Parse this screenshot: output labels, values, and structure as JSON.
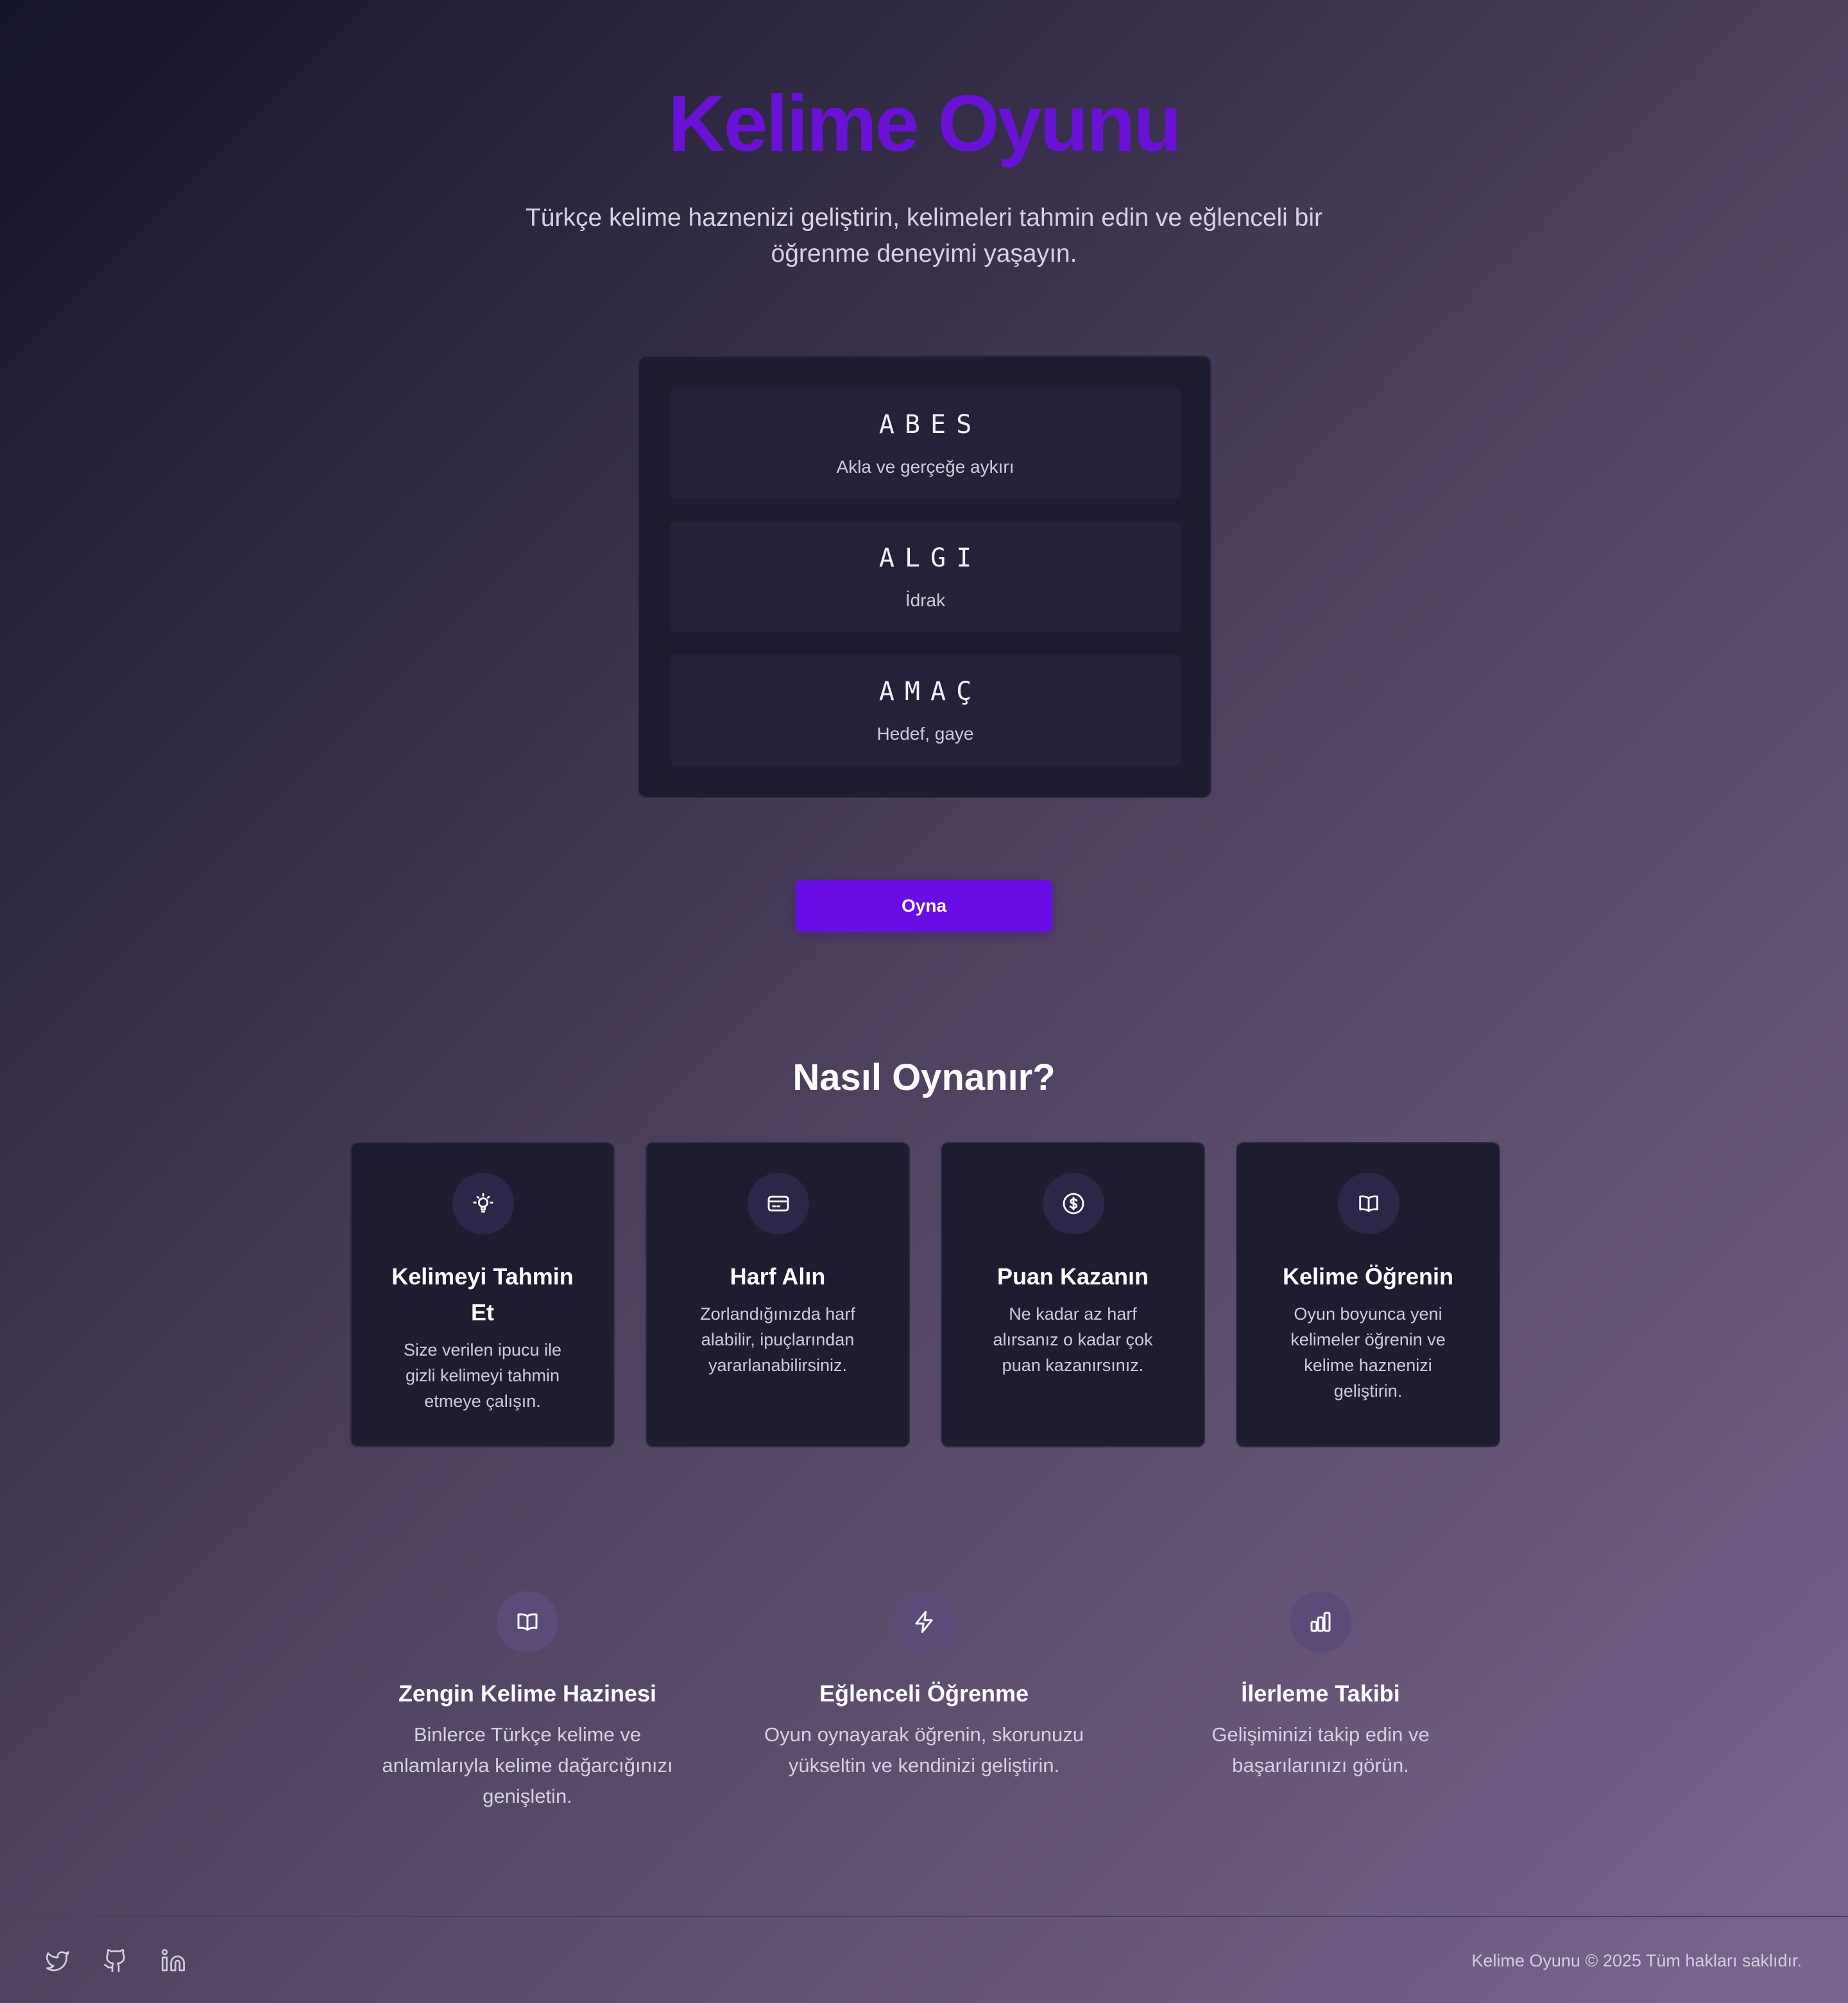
{
  "hero": {
    "title": "Kelime Oyunu",
    "subtitle": "Türkçe kelime haznenizi geliştirin, kelimeleri tahmin edin ve eğlenceli bir öğrenme deneyimi yaşayın."
  },
  "words": [
    {
      "word": "ABES",
      "hint": "Akla ve gerçeğe aykırı"
    },
    {
      "word": "ALGI",
      "hint": "İdrak"
    },
    {
      "word": "AMAÇ",
      "hint": "Hedef, gaye"
    }
  ],
  "play_button": "Oyna",
  "how_to_play": {
    "title": "Nasıl Oynanır?",
    "steps": [
      {
        "icon": "lightbulb-icon",
        "title": "Kelimeyi Tahmin Et",
        "desc": "Size verilen ipucu ile gizli kelimeyi tahmin etmeye çalışın."
      },
      {
        "icon": "credit-card-icon",
        "title": "Harf Alın",
        "desc": "Zorlandığınızda harf alabilir, ipuçlarından yararlanabilirsiniz."
      },
      {
        "icon": "dollar-circle-icon",
        "title": "Puan Kazanın",
        "desc": "Ne kadar az harf alırsanız o kadar çok puan kazanırsınız."
      },
      {
        "icon": "open-book-icon",
        "title": "Kelime Öğrenin",
        "desc": "Oyun boyunca yeni kelimeler öğrenin ve kelime haznenizi geliştirin."
      }
    ]
  },
  "features": [
    {
      "icon": "open-book-icon",
      "title": "Zengin Kelime Hazinesi",
      "desc": "Binlerce Türkçe kelime ve anlamlarıyla kelime dağarcığınızı genişletin."
    },
    {
      "icon": "lightning-icon",
      "title": "Eğlenceli Öğrenme",
      "desc": "Oyun oynayarak öğrenin, skorunuzu yükseltin ve kendinizi geliştirin."
    },
    {
      "icon": "bar-chart-icon",
      "title": "İlerleme Takibi",
      "desc": "Gelişiminizi takip edin ve başarılarınızı görün."
    }
  ],
  "footer": {
    "social": [
      "twitter-icon",
      "github-icon",
      "linkedin-icon"
    ],
    "copyright": "Kelime Oyunu © 2025 Tüm hakları saklıdır."
  },
  "colors": {
    "accent": "#6a0ee8",
    "title": "#6a12d6",
    "card_bg": "#1e1c30"
  }
}
